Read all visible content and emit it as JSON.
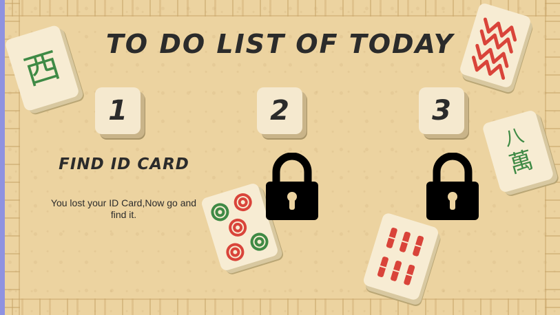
{
  "page": {
    "title": "TO DO LIST OF TODAY"
  },
  "tasks": [
    {
      "number": "1",
      "name": "FIND ID CARD",
      "description": "You lost your ID Card,Now go and find it.",
      "status": "unlocked"
    },
    {
      "number": "2",
      "status": "locked"
    },
    {
      "number": "3",
      "status": "locked"
    }
  ],
  "decorations": {
    "tile_west": "西",
    "tile_eight_top": "八",
    "tile_eight_bottom": "萬"
  },
  "colors": {
    "background": "#ecd3a0",
    "frame_outer": "#8f92e0",
    "tile_face": "#f5e9cf",
    "text": "#2b2b2b",
    "mahjong_red": "#d9443a",
    "mahjong_green": "#3f8a45"
  },
  "icons": {
    "lock": "lock-icon"
  }
}
